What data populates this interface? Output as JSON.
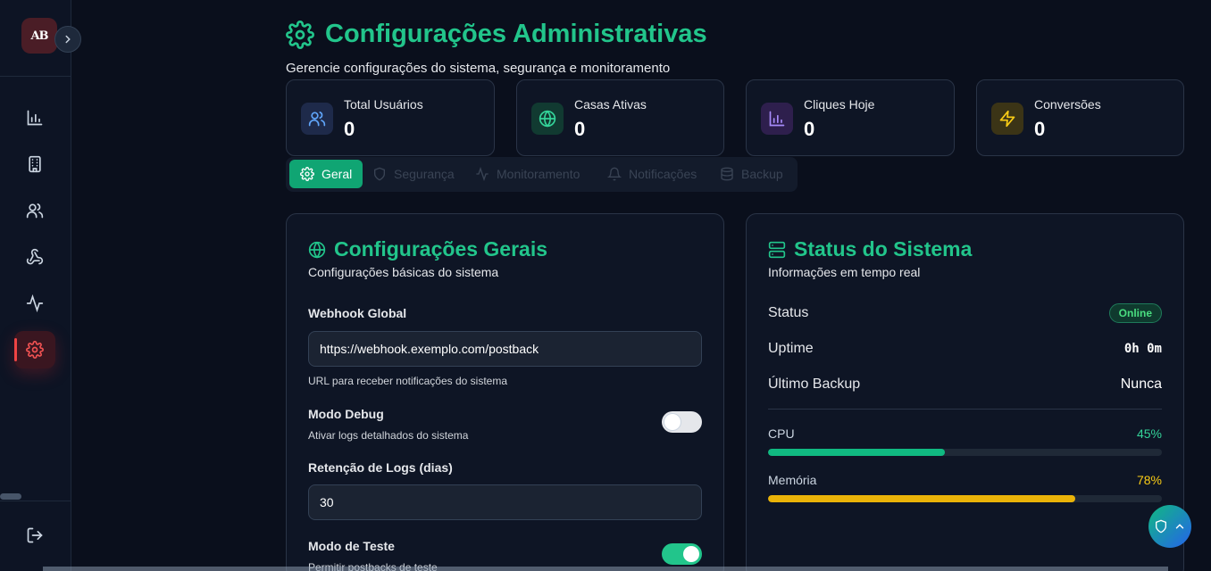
{
  "sidebar": {
    "logo_text": "AB",
    "nav": [
      {
        "name": "dashboard",
        "icon": "bar-chart-icon"
      },
      {
        "name": "houses",
        "icon": "building-icon"
      },
      {
        "name": "users",
        "icon": "users-icon"
      },
      {
        "name": "webhooks",
        "icon": "webhook-icon"
      },
      {
        "name": "monitoring",
        "icon": "activity-icon"
      },
      {
        "name": "settings",
        "icon": "gear-icon",
        "active": true
      }
    ]
  },
  "header": {
    "title": "Configurações Administrativas",
    "subtitle": "Gerencie configurações do sistema, segurança e monitoramento"
  },
  "stats": [
    {
      "label": "Total Usuários",
      "value": "0",
      "icon": "users-icon",
      "color": "#60a5fa"
    },
    {
      "label": "Casas Ativas",
      "value": "0",
      "icon": "globe-icon",
      "color": "#34d399"
    },
    {
      "label": "Cliques Hoje",
      "value": "0",
      "icon": "bar-chart-icon",
      "color": "#a78bfa"
    },
    {
      "label": "Conversões",
      "value": "0",
      "icon": "zap-icon",
      "color": "#facc15"
    }
  ],
  "tabs": [
    {
      "label": "Geral",
      "active": true
    },
    {
      "label": "Segurança"
    },
    {
      "label": "Monitoramento"
    },
    {
      "label": "Notificações"
    },
    {
      "label": "Backup"
    }
  ],
  "general": {
    "title": "Configurações Gerais",
    "subtitle": "Configurações básicas do sistema",
    "webhook_label": "Webhook Global",
    "webhook_value": "https://webhook.exemplo.com/postback",
    "webhook_hint": "URL para receber notificações do sistema",
    "debug_label": "Modo Debug",
    "debug_hint": "Ativar logs detalhados do sistema",
    "debug_on": false,
    "retention_label": "Retenção de Logs (dias)",
    "retention_value": "30",
    "test_label": "Modo de Teste",
    "test_hint": "Permitir postbacks de teste",
    "test_on": true
  },
  "status": {
    "title": "Status do Sistema",
    "subtitle": "Informações em tempo real",
    "status_label": "Status",
    "status_badge": "Online",
    "uptime_label": "Uptime",
    "uptime_value": "0h 0m",
    "backup_label": "Último Backup",
    "backup_value": "Nunca",
    "cpu_label": "CPU",
    "cpu_pct": "45%",
    "cpu_value": 0.45,
    "cpu_color": "#10b981",
    "mem_label": "Memória",
    "mem_pct": "78%",
    "mem_value": 0.78,
    "mem_color": "#eab308"
  },
  "colors": {
    "accent": "#22c58b",
    "danger": "#ef4444"
  }
}
